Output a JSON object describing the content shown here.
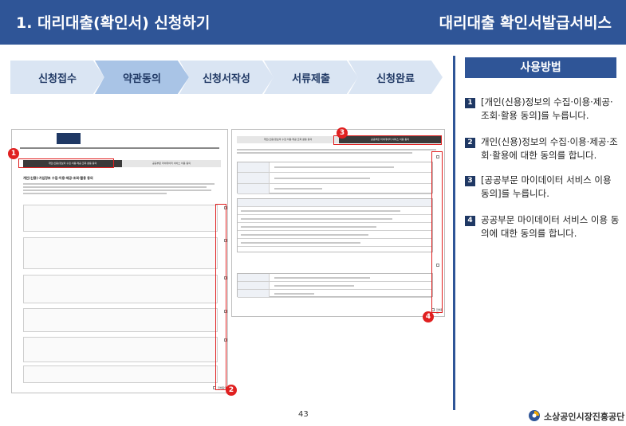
{
  "header": {
    "title": "1. 대리대출(확인서) 신청하기",
    "service": "대리대출 확인서발급서비스"
  },
  "steps": [
    {
      "label": "신청접수",
      "active": false
    },
    {
      "label": "약관동의",
      "active": true
    },
    {
      "label": "신청서작성",
      "active": false
    },
    {
      "label": "서류제출",
      "active": false
    },
    {
      "label": "신청완료",
      "active": false
    }
  ],
  "usage": {
    "title": "사용방법",
    "items": [
      {
        "num": "1",
        "text": "[개인(신용)정보의 수집·이용·제공·조회·활용 동의]를 누릅니다."
      },
      {
        "num": "2",
        "text": "개인(신용)정보의 수집·이용·제공·조회·활용에 대한 동의를 합니다."
      },
      {
        "num": "3",
        "text": "[공공부문 마이데이터 서비스 이용 동의]를 누릅니다."
      },
      {
        "num": "4",
        "text": "공공부문 마이데이터 서비스 이용 동의에 대한 동의를 합니다."
      }
    ]
  },
  "shot1": {
    "tab_active": "개인(신용)정보의 수집·이용·제공·조회·활용 동의",
    "tab_other": "공공부문 마이데이터 서비스 이용 동의",
    "heading": "개인(신용)·가입정보 수집·이용·제공·조회·활용 동의",
    "agree_label": "동의함",
    "agree_all_label": "전체동의"
  },
  "shot2": {
    "tab_other": "개인(신용)정보의 수집·이용·제공·조회·활용 동의",
    "tab_active": "공공부문 마이데이터 서비스 이용 동의",
    "agree_label": "동의함",
    "agree_all_label": "전체동의"
  },
  "badges": [
    "1",
    "2",
    "3",
    "4"
  ],
  "page_number": "43",
  "org_name": "소상공인시장진흥공단",
  "colors": {
    "header": "#2f5597",
    "highlight": "#e02020",
    "step": "#dae5f3",
    "step_active": "#a9c4e6"
  }
}
